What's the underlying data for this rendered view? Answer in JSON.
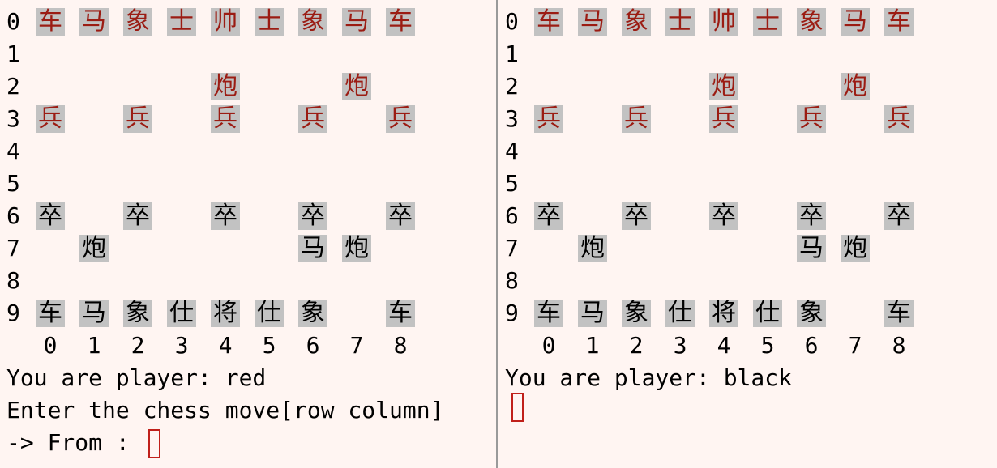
{
  "row_numbers": [
    "0",
    "1",
    "2",
    "3",
    "4",
    "5",
    "6",
    "7",
    "8",
    "9"
  ],
  "column_labels": [
    "0",
    "1",
    "2",
    "3",
    "4",
    "5",
    "6",
    "7",
    "8"
  ],
  "board": [
    [
      [
        "车",
        "red"
      ],
      [
        "马",
        "red"
      ],
      [
        "象",
        "red"
      ],
      [
        "士",
        "red"
      ],
      [
        "帅",
        "red"
      ],
      [
        "士",
        "red"
      ],
      [
        "象",
        "red"
      ],
      [
        "马",
        "red"
      ],
      [
        "车",
        "red"
      ]
    ],
    [
      null,
      null,
      null,
      null,
      null,
      null,
      null,
      null,
      null
    ],
    [
      null,
      null,
      null,
      null,
      [
        "炮",
        "red"
      ],
      null,
      null,
      [
        "炮",
        "red"
      ],
      null
    ],
    [
      [
        "兵",
        "red"
      ],
      null,
      [
        "兵",
        "red"
      ],
      null,
      [
        "兵",
        "red"
      ],
      null,
      [
        "兵",
        "red"
      ],
      null,
      [
        "兵",
        "red"
      ]
    ],
    [
      null,
      null,
      null,
      null,
      null,
      null,
      null,
      null,
      null
    ],
    [
      null,
      null,
      null,
      null,
      null,
      null,
      null,
      null,
      null
    ],
    [
      [
        "卒",
        "black"
      ],
      null,
      [
        "卒",
        "black"
      ],
      null,
      [
        "卒",
        "black"
      ],
      null,
      [
        "卒",
        "black"
      ],
      null,
      [
        "卒",
        "black"
      ]
    ],
    [
      null,
      [
        "炮",
        "black"
      ],
      null,
      null,
      null,
      null,
      [
        "马",
        "black"
      ],
      [
        "炮",
        "black"
      ],
      null
    ],
    [
      null,
      null,
      null,
      null,
      null,
      null,
      null,
      null,
      null
    ],
    [
      [
        "车",
        "black"
      ],
      [
        "马",
        "black"
      ],
      [
        "象",
        "black"
      ],
      [
        "仕",
        "black"
      ],
      [
        "将",
        "black"
      ],
      [
        "仕",
        "black"
      ],
      [
        "象",
        "black"
      ],
      null,
      [
        "车",
        "black"
      ]
    ]
  ],
  "left_terminal": {
    "player_line": "You are player: red",
    "prompt_line": "Enter the chess move[row column]",
    "from_line": "-> From : "
  },
  "right_terminal": {
    "player_line": "You are player: black"
  },
  "colors": {
    "background": "#fff5f2",
    "red_piece": "#9b1c13",
    "black_piece": "#000000",
    "piece_bg": "#c2c2c2",
    "cursor": "#c0201a"
  }
}
